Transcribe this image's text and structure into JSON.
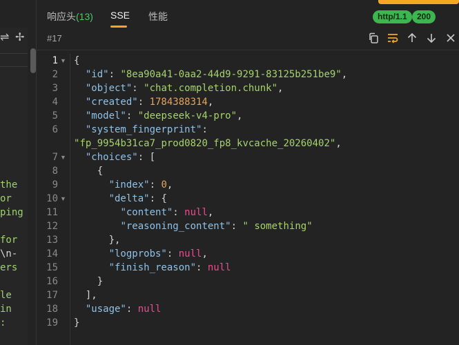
{
  "tabs": [
    {
      "label": "响应头",
      "count": "(13)"
    },
    {
      "label": "SSE"
    },
    {
      "label": "性能"
    }
  ],
  "badges": {
    "protocol": "http/1.1",
    "status": "200",
    "status_color": "#3cb64f"
  },
  "accent": "#f5a623",
  "event_id": "#17",
  "toolbar_icons": [
    "copy-icon",
    "wrap-icon",
    "arrow-up-icon",
    "arrow-down-icon",
    "close-icon"
  ],
  "left_panel": {
    "icons": [
      "sort-icon",
      "magic-wand-icon"
    ],
    "fragments": [
      {
        "text": "the",
        "color": "green"
      },
      {
        "text": "or",
        "color": "green"
      },
      {
        "text": "ping",
        "color": "green"
      },
      {
        "text": "for",
        "color": "green"
      },
      {
        "text": " \\n-",
        "color": "white"
      },
      {
        "text": "ers",
        "color": "green"
      },
      {
        "text": "le",
        "color": "green"
      },
      {
        "text": "in",
        "color": "green"
      },
      {
        "text": ":",
        "color": "green"
      }
    ]
  },
  "line_numbers": [
    "1",
    "2",
    "3",
    "4",
    "5",
    "6",
    "",
    "7",
    "8",
    "9",
    "10",
    "11",
    "12",
    "13",
    "14",
    "15",
    "16",
    "17",
    "18",
    "19"
  ],
  "code": {
    "id": "8ea90a41-0aa2-44d9-9291-83125b251be9",
    "object": "chat.completion.chunk",
    "created": "1784388314",
    "model": "deepseek-v4-pro",
    "system_fingerprint": "fp_9954b31ca7_prod0820_fp8_kvcache_20260402",
    "index": "0",
    "content": "null",
    "reasoning_content": " something",
    "logprobs": "null",
    "finish_reason": "null",
    "usage": "null"
  }
}
